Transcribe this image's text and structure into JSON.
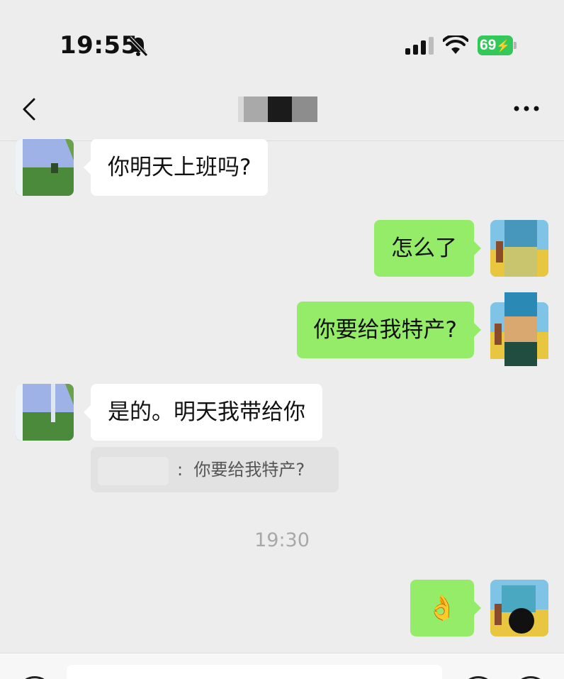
{
  "status_bar": {
    "time": "19:55",
    "battery_level": "69",
    "battery_color": "#34c759",
    "icons": [
      "bell-slash-icon",
      "cellular-signal-icon",
      "wifi-icon",
      "battery-charging-icon"
    ]
  },
  "nav": {
    "back_icon": "chevron-left-icon",
    "more_icon": "more-dots-icon"
  },
  "messages": [
    {
      "direction": "in",
      "text": "你明天上班吗?"
    },
    {
      "direction": "out",
      "text": "怎么了"
    },
    {
      "direction": "out",
      "text": "你要给我特产?"
    },
    {
      "direction": "in",
      "text": "是的。明天我带给你",
      "quote": {
        "separator": ":",
        "text": "你要给我特产?"
      }
    },
    {
      "direction": "out",
      "text": "👌"
    }
  ],
  "time_divider": "19:30",
  "colors": {
    "background": "#ededed",
    "incoming_bubble": "#ffffff",
    "outgoing_bubble": "#95ec69"
  }
}
